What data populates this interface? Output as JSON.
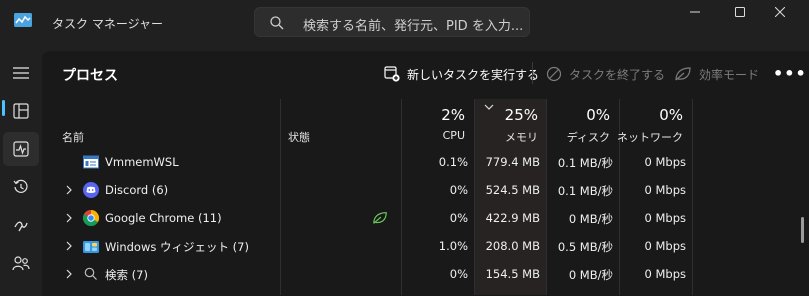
{
  "window": {
    "title": "タスク マネージャー",
    "search_placeholder": "検索する名前、発行元、PID を入力..."
  },
  "page": {
    "title": "プロセス"
  },
  "toolbar": {
    "new_task": "新しいタスクを実行する",
    "end_task": "タスクを終了する",
    "efficiency_mode": "効率モード",
    "more": "•••"
  },
  "columns": {
    "name": "名前",
    "status": "状態",
    "cpu": {
      "percent": "2%",
      "label": "CPU"
    },
    "memory": {
      "percent": "25%",
      "label": "メモリ"
    },
    "disk": {
      "percent": "0%",
      "label": "ディスク"
    },
    "network": {
      "percent": "0%",
      "label": "ネットワーク"
    }
  },
  "processes": [
    {
      "name": "VmmemWSL",
      "icon": "vmmem-icon",
      "expandable": false,
      "cpu": "0.1%",
      "memory": "779.4 MB",
      "disk": "0.1 MB/秒",
      "network": "0 Mbps"
    },
    {
      "name": "Discord (6)",
      "icon": "discord-icon",
      "expandable": true,
      "cpu": "0%",
      "memory": "524.5 MB",
      "disk": "0.1 MB/秒",
      "network": "0 Mbps"
    },
    {
      "name": "Google Chrome (11)",
      "icon": "chrome-icon",
      "expandable": true,
      "cpu": "0%",
      "memory": "422.9 MB",
      "disk": "0 MB/秒",
      "network": "0 Mbps",
      "status_icon": "efficiency-leaf-icon"
    },
    {
      "name": "Windows ウィジェット (7)",
      "icon": "widgets-icon",
      "expandable": true,
      "cpu": "1.0%",
      "memory": "208.0 MB",
      "disk": "0.5 MB/秒",
      "network": "0 Mbps"
    },
    {
      "name": "検索 (7)",
      "icon": "search-icon",
      "expandable": true,
      "cpu": "0%",
      "memory": "154.5 MB",
      "disk": "0 MB/秒",
      "network": "0 Mbps"
    }
  ],
  "nav": [
    {
      "name": "hamburger-menu-icon"
    },
    {
      "name": "processes-icon",
      "active": true
    },
    {
      "name": "performance-icon"
    },
    {
      "name": "app-history-icon"
    },
    {
      "name": "startup-apps-icon"
    },
    {
      "name": "users-icon"
    }
  ],
  "colors": {
    "background": "#202020",
    "panel": "#191919",
    "accent": "#4cc2ff",
    "memory_highlight": "#262322",
    "leaf_green": "#6ccb5f"
  }
}
